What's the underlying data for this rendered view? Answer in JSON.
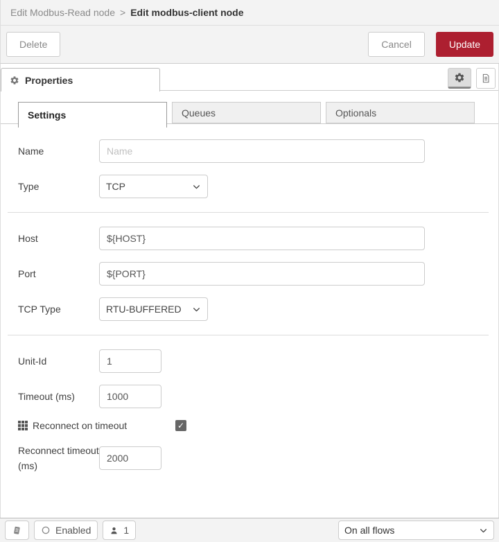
{
  "breadcrumb": {
    "parent": "Edit Modbus-Read node",
    "separator": ">",
    "current": "Edit modbus-client node"
  },
  "toolbar": {
    "delete": "Delete",
    "cancel": "Cancel",
    "update": "Update"
  },
  "panel": {
    "properties": "Properties"
  },
  "tabs": {
    "settings": "Settings",
    "queues": "Queues",
    "optionals": "Optionals",
    "active": "Settings"
  },
  "form": {
    "name": {
      "label": "Name",
      "placeholder": "Name",
      "value": ""
    },
    "type": {
      "label": "Type",
      "value": "TCP"
    },
    "host": {
      "label": "Host",
      "value": "${HOST}"
    },
    "port": {
      "label": "Port",
      "value": "${PORT}"
    },
    "tcp_type": {
      "label": "TCP Type",
      "value": "RTU-BUFFERED"
    },
    "unit_id": {
      "label": "Unit-Id",
      "value": "1"
    },
    "timeout_ms": {
      "label": "Timeout (ms)",
      "value": "1000"
    },
    "reconnect_on_timeout": {
      "label": "Reconnect on timeout",
      "checked": true
    },
    "reconnect_timeout_ms": {
      "label": "Reconnect timeout (ms)",
      "value": "2000"
    }
  },
  "footer": {
    "enabled": "Enabled",
    "instances": "1",
    "scope": "On all flows"
  },
  "icons": {
    "properties_tab": "gear-icon",
    "panel_settings": "gear-icon",
    "panel_docs": "document-icon",
    "reconnect": "grid-icon",
    "footer_log": "book-icon",
    "footer_enabled": "circle-icon",
    "footer_instances": "user-icon",
    "selects": "chevron-down-icon"
  },
  "colors": {
    "accent_red": "#AD1F30",
    "chrome_bg": "#f3f3f3",
    "border": "#cccccc",
    "checkbox_fill": "#666666"
  }
}
